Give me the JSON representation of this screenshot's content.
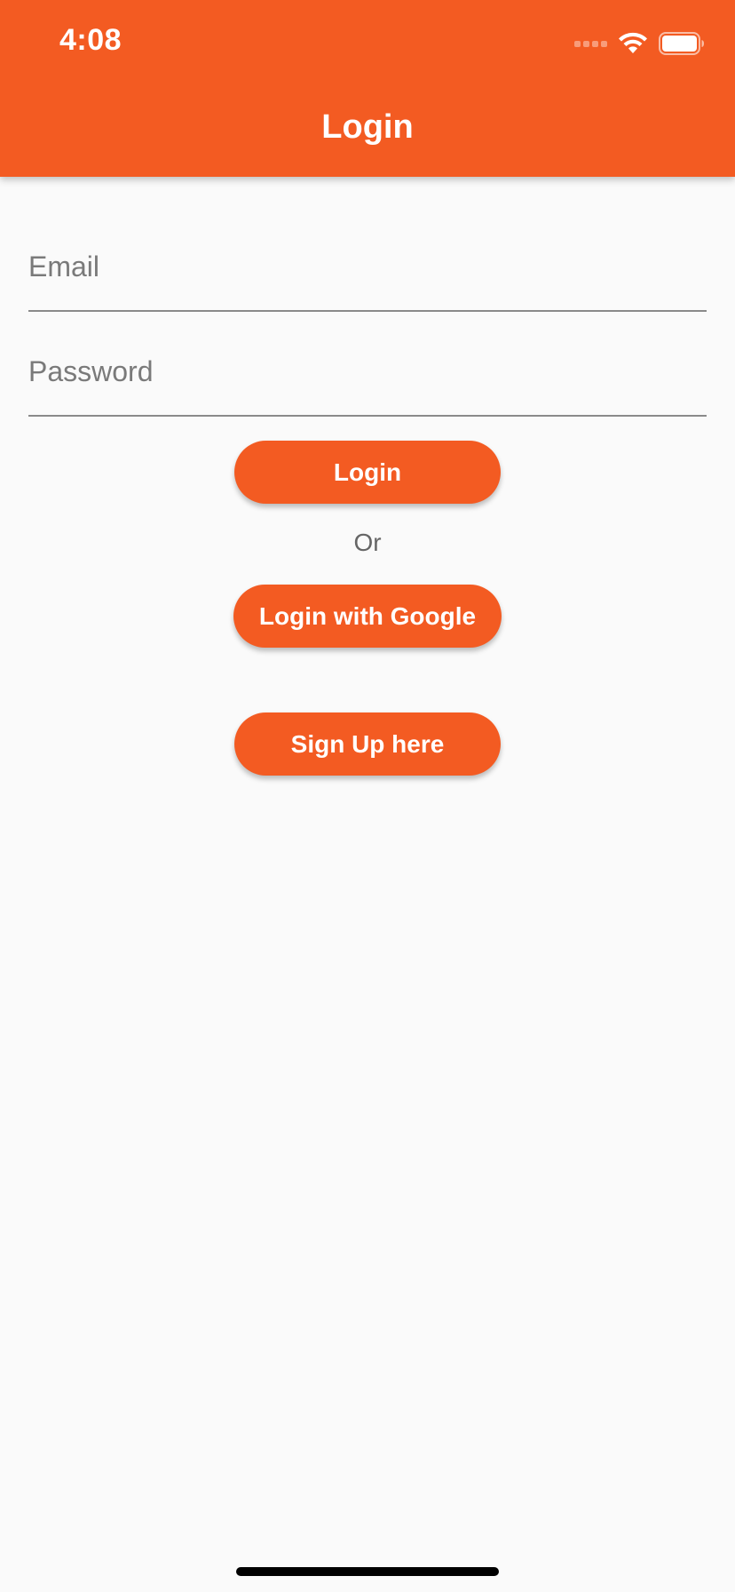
{
  "status_bar": {
    "time": "4:08"
  },
  "app_bar": {
    "title": "Login"
  },
  "form": {
    "email_placeholder": "Email",
    "password_placeholder": "Password"
  },
  "buttons": {
    "login_label": "Login",
    "separator_text": "Or",
    "google_label": "Login with Google",
    "signup_label": "Sign Up here"
  },
  "colors": {
    "primary": "#f35b22",
    "background": "#fafafa",
    "placeholder": "#7a7a7a"
  },
  "icons": {
    "signal": "cellular-signal-icon",
    "wifi": "wifi-icon",
    "battery": "battery-icon"
  }
}
